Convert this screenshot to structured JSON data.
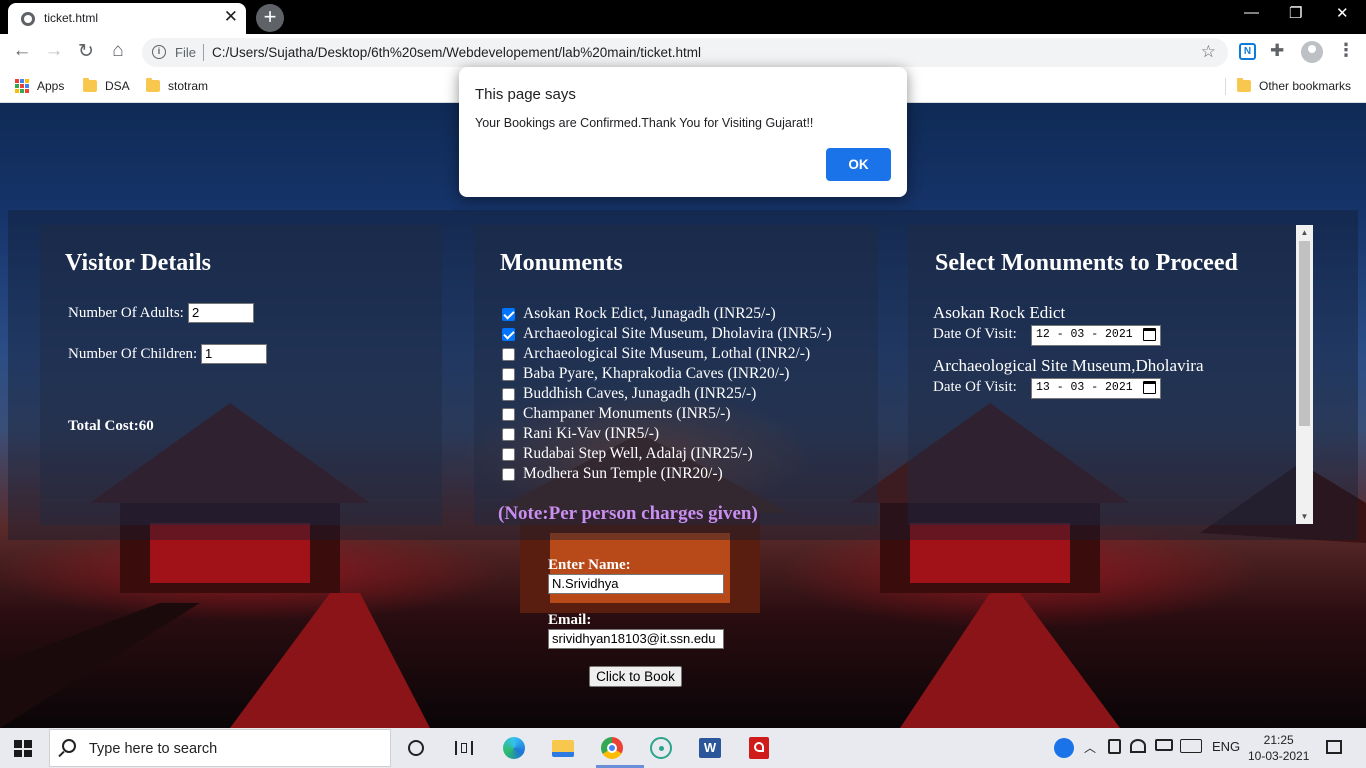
{
  "browser": {
    "tab_title": "ticket.html",
    "url_scheme_label": "File",
    "url": "C:/Users/Sujatha/Desktop/6th%20sem/Webdevelopement/lab%20main/ticket.html",
    "bookmarks": [
      "Apps",
      "DSA",
      "stotram"
    ],
    "other_bookmarks": "Other bookmarks",
    "new_tab_symbol": "+",
    "close_symbol": "✕",
    "minimize_symbol": "—",
    "restore_symbol": "❐",
    "window_close_symbol": "✕",
    "back_symbol": "←",
    "forward_symbol": "→",
    "reload_symbol": "↻",
    "home_symbol": "⌂",
    "info_symbol": "i",
    "star_symbol": "☆",
    "ext_letter": "N",
    "puzzle_symbol": "✚",
    "menu_symbol": "⋮"
  },
  "dialog": {
    "title": "This page says",
    "message": "Your Bookings are Confirmed.Thank You for Visiting Gujarat!!",
    "ok_label": "OK"
  },
  "visitor": {
    "heading": "Visitor Details",
    "adults_label": "Number Of Adults:",
    "adults_value": "2",
    "children_label": "Number Of Children:",
    "children_value": "1",
    "total_label": "Total Cost:60"
  },
  "monuments": {
    "heading": "Monuments",
    "items": [
      {
        "label": "Asokan Rock Edict, Junagadh (INR25/-)",
        "checked": true
      },
      {
        "label": "Archaeological Site Museum, Dholavira (INR5/-)",
        "checked": true
      },
      {
        "label": "Archaeological Site Museum, Lothal (INR2/-)",
        "checked": false
      },
      {
        "label": "Baba Pyare, Khaprakodia Caves (INR20/-)",
        "checked": false
      },
      {
        "label": "Buddhish Caves, Junagadh (INR25/-)",
        "checked": false
      },
      {
        "label": "Champaner Monuments (INR5/-)",
        "checked": false
      },
      {
        "label": "Rani Ki-Vav (INR5/-)",
        "checked": false
      },
      {
        "label": "Rudabai Step Well, Adalaj (INR25/-)",
        "checked": false
      },
      {
        "label": "Modhera Sun Temple (INR20/-)",
        "checked": false
      }
    ],
    "note": "(Note:Per person charges given)"
  },
  "selected": {
    "heading": "Select Monuments to Proceed",
    "entries": [
      {
        "name": "Asokan Rock Edict",
        "date_label": "Date Of Visit:",
        "date_value": "12 - 03 - 2021"
      },
      {
        "name": "Archaeological Site Museum,Dholavira",
        "date_label": "Date Of Visit:",
        "date_value": "13 - 03 - 2021"
      }
    ]
  },
  "form": {
    "name_label": "Enter Name:",
    "name_value": "N.Srividhya",
    "email_label": "Email:",
    "email_value": "srividhyan18103@it.ssn.edu",
    "book_label": "Click to Book"
  },
  "taskbar": {
    "search_placeholder": "Type here to search",
    "language": "ENG",
    "time": "21:25",
    "date": "10-03-2021"
  },
  "colors": {
    "note": "#c98ff0",
    "checkbox_checked": "#0075ff",
    "ok_button": "#1a73e8"
  }
}
